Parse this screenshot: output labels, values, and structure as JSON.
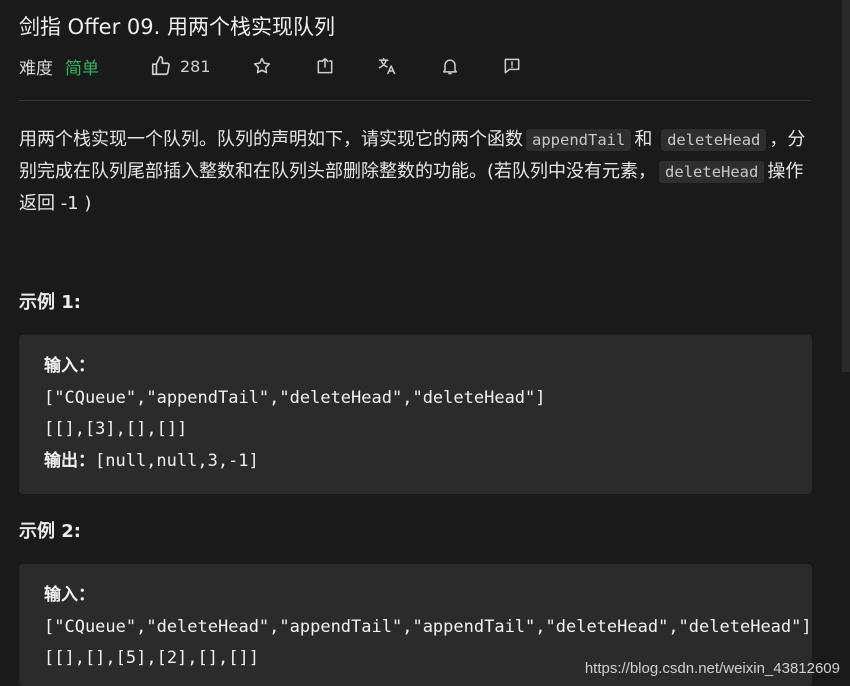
{
  "problem": {
    "title": "剑指 Offer 09. 用两个栈实现队列",
    "difficulty_label": "难度",
    "difficulty": "简单",
    "likes": "281"
  },
  "toolbar": {
    "icons": [
      "thumbs-up-icon",
      "star-icon",
      "share-icon",
      "translate-icon",
      "bell-icon",
      "feedback-icon"
    ]
  },
  "description": {
    "t1": "用两个栈实现一个队列。队列的声明如下，请实现它的两个函数",
    "c1": "appendTail",
    "t2": "和",
    "c2": "deleteHead",
    "t3": "，分别完成在队列尾部插入整数和在队列头部删除整数的功能。(若队列中没有元素，",
    "c3": "deleteHead",
    "t4": "操作返回 -1 )"
  },
  "examples": [
    {
      "title": "示例 1:",
      "input_label": "输入：",
      "line1": "[\"CQueue\",\"appendTail\",\"deleteHead\",\"deleteHead\"]",
      "line2": "[[],[3],[],[]]",
      "output_label": "输出：",
      "output": "[null,null,3,-1]"
    },
    {
      "title": "示例 2:",
      "input_label": "输入：",
      "line1": "[\"CQueue\",\"deleteHead\",\"appendTail\",\"appendTail\",\"deleteHead\",\"deleteHead\"]",
      "line2": "[[],[],[5],[2],[],[]]"
    }
  ],
  "watermark": "https://blog.csdn.net/weixin_43812609",
  "colors": {
    "background": "#1a1a1a",
    "difficulty_easy": "#2db55d",
    "code_block": "#2b2b2b"
  }
}
